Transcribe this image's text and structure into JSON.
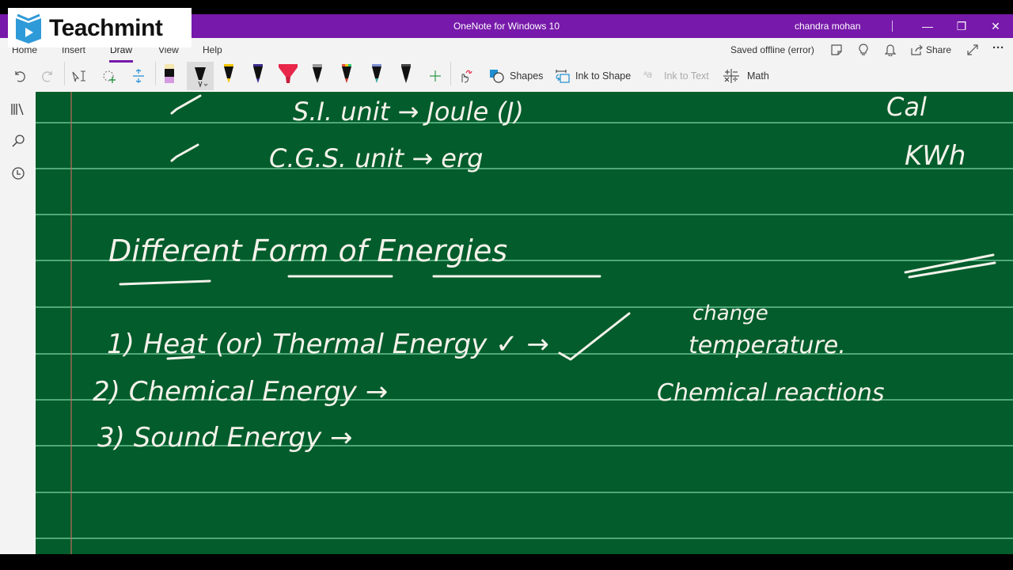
{
  "logo": {
    "name": "Teachmint"
  },
  "titlebar": {
    "title": "OneNote for Windows 10",
    "user": "chandra mohan",
    "buttons": {
      "minimize": "—",
      "restore": "❐",
      "close": "✕"
    }
  },
  "ribbon": {
    "tabs": [
      {
        "label": "Home"
      },
      {
        "label": "Insert"
      },
      {
        "label": "Draw",
        "active": true
      },
      {
        "label": "View"
      },
      {
        "label": "Help"
      }
    ],
    "status": "Saved offline (error)",
    "share_label": "Share",
    "more": "···",
    "tools": {
      "shapes": "Shapes",
      "ink_to_shape": "Ink to Shape",
      "ink_to_text": "Ink to Text",
      "math": "Math"
    },
    "pens": [
      {
        "name": "eraser",
        "color": "#e6b8e8"
      },
      {
        "name": "black-pen",
        "color": "#111111",
        "selected": true
      },
      {
        "name": "yellow-pen",
        "color": "#f2c400"
      },
      {
        "name": "indigo-pen",
        "color": "#3a2b8c"
      },
      {
        "name": "red-highlighter",
        "color": "#e8264a"
      },
      {
        "name": "gray-pencil",
        "color": "#888888"
      },
      {
        "name": "rainbow-pen",
        "color": "#c0392b"
      },
      {
        "name": "galaxy-pen",
        "color": "#3aa6a0"
      },
      {
        "name": "black-pen-2",
        "color": "#111111"
      }
    ],
    "accent": "#7719aa"
  },
  "sidebar": {
    "items": [
      {
        "name": "notebooks",
        "icon": "books-icon"
      },
      {
        "name": "search",
        "icon": "search-icon"
      },
      {
        "name": "recent",
        "icon": "clock-icon"
      }
    ]
  },
  "page": {
    "background": "#025c2b",
    "notes": {
      "units_si": "S.I. unit → Joule (J)",
      "units_cgs": "C.G.S. unit → erg",
      "side_cal": "Cal",
      "side_kwh": "KWh",
      "heading": "Different Form of Energies",
      "item1": "1) Heat (or) Thermal Energy ✓ →",
      "item1_note_top": "change",
      "item1_note": "temperature.",
      "item2": "2) Chemical Energy →",
      "item2_note": "Chemical reactions",
      "item3": "3) Sound Energy →"
    }
  }
}
